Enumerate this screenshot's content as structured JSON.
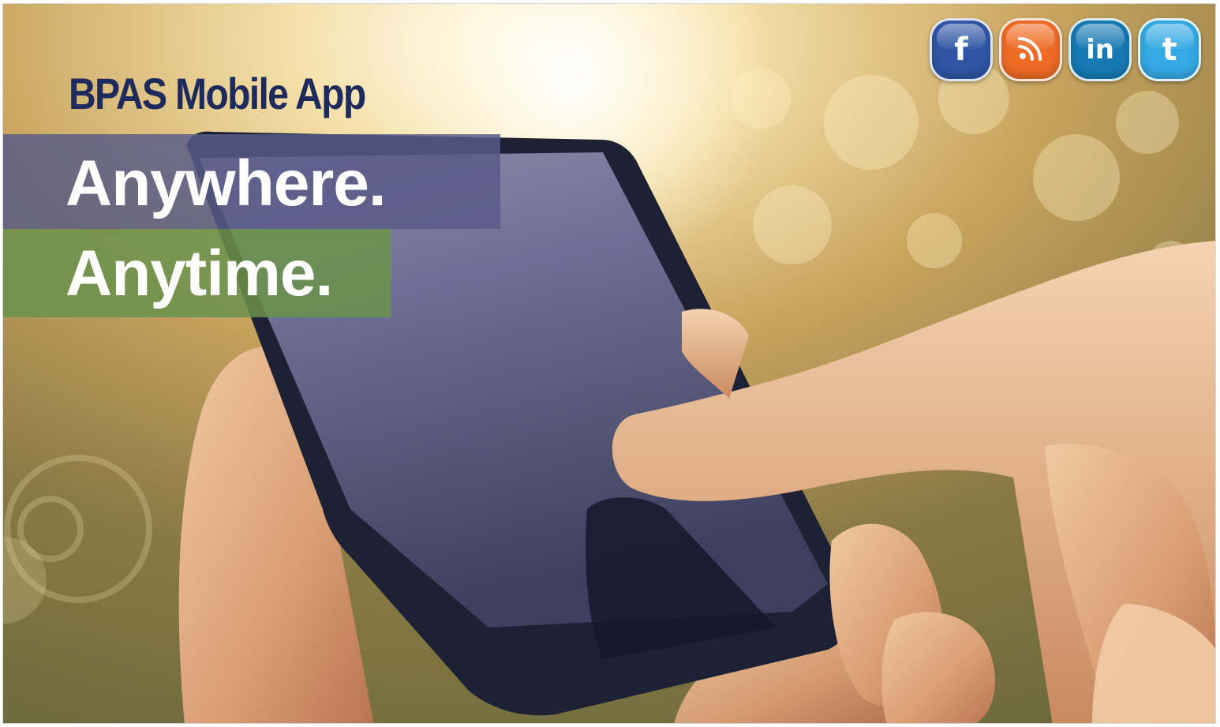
{
  "banner": {
    "app_title": "BPAS Mobile App",
    "line_1": "Anywhere.",
    "line_2": "Anytime."
  },
  "social": [
    {
      "id": "facebook",
      "glyph": "f",
      "icon": "facebook-icon",
      "color": "#2f55a4"
    },
    {
      "id": "rss",
      "glyph": "",
      "icon": "rss-icon",
      "color": "#ee6b24"
    },
    {
      "id": "linkedin",
      "glyph": "in",
      "icon": "linkedin-icon",
      "color": "#1779b4"
    },
    {
      "id": "twitter",
      "glyph": "t",
      "icon": "twitter-icon",
      "color": "#34a9e4"
    }
  ],
  "colors": {
    "title": "#1f2a5c",
    "band_1": "#585a87",
    "band_2": "#6a924c"
  }
}
